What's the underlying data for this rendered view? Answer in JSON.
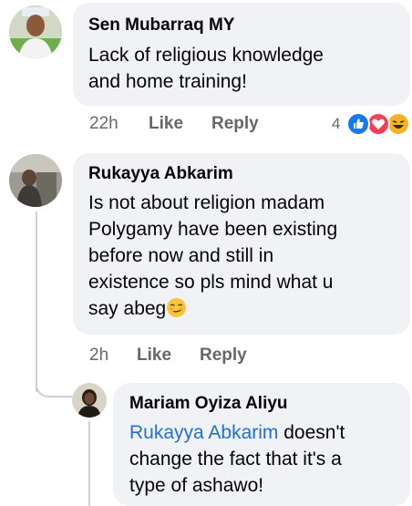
{
  "comments": [
    {
      "author": "Sen Mubarraq MY",
      "lines": [
        "Lack of religious knowledge",
        "and home training!"
      ],
      "time": "22h",
      "like_label": "Like",
      "reply_label": "Reply",
      "reaction_count": "4",
      "reactions": [
        "like-icon",
        "love-icon",
        "haha-icon"
      ]
    },
    {
      "author": "Rukayya Abkarim",
      "lines": [
        "Is not about religion madam",
        "Polygamy have been existing",
        "before now and still in",
        "existence so pls mind what u",
        "say abeg"
      ],
      "trailing_emoji": "smirk-face-icon",
      "time": "2h",
      "like_label": "Like",
      "reply_label": "Reply"
    },
    {
      "author": "Mariam Oyiza Aliyu",
      "mention": "Rukayya Abkarim",
      "lines": [
        "doesn't",
        "change the fact that it's a",
        "type of ashawo!"
      ]
    }
  ],
  "colors": {
    "bubble": "#f0f2f5",
    "meta_text": "#65676b",
    "mention": "#216fdb",
    "like_blue": "#1877f2",
    "love_red": "#f33e58",
    "haha_yellow": "#f7b125"
  }
}
